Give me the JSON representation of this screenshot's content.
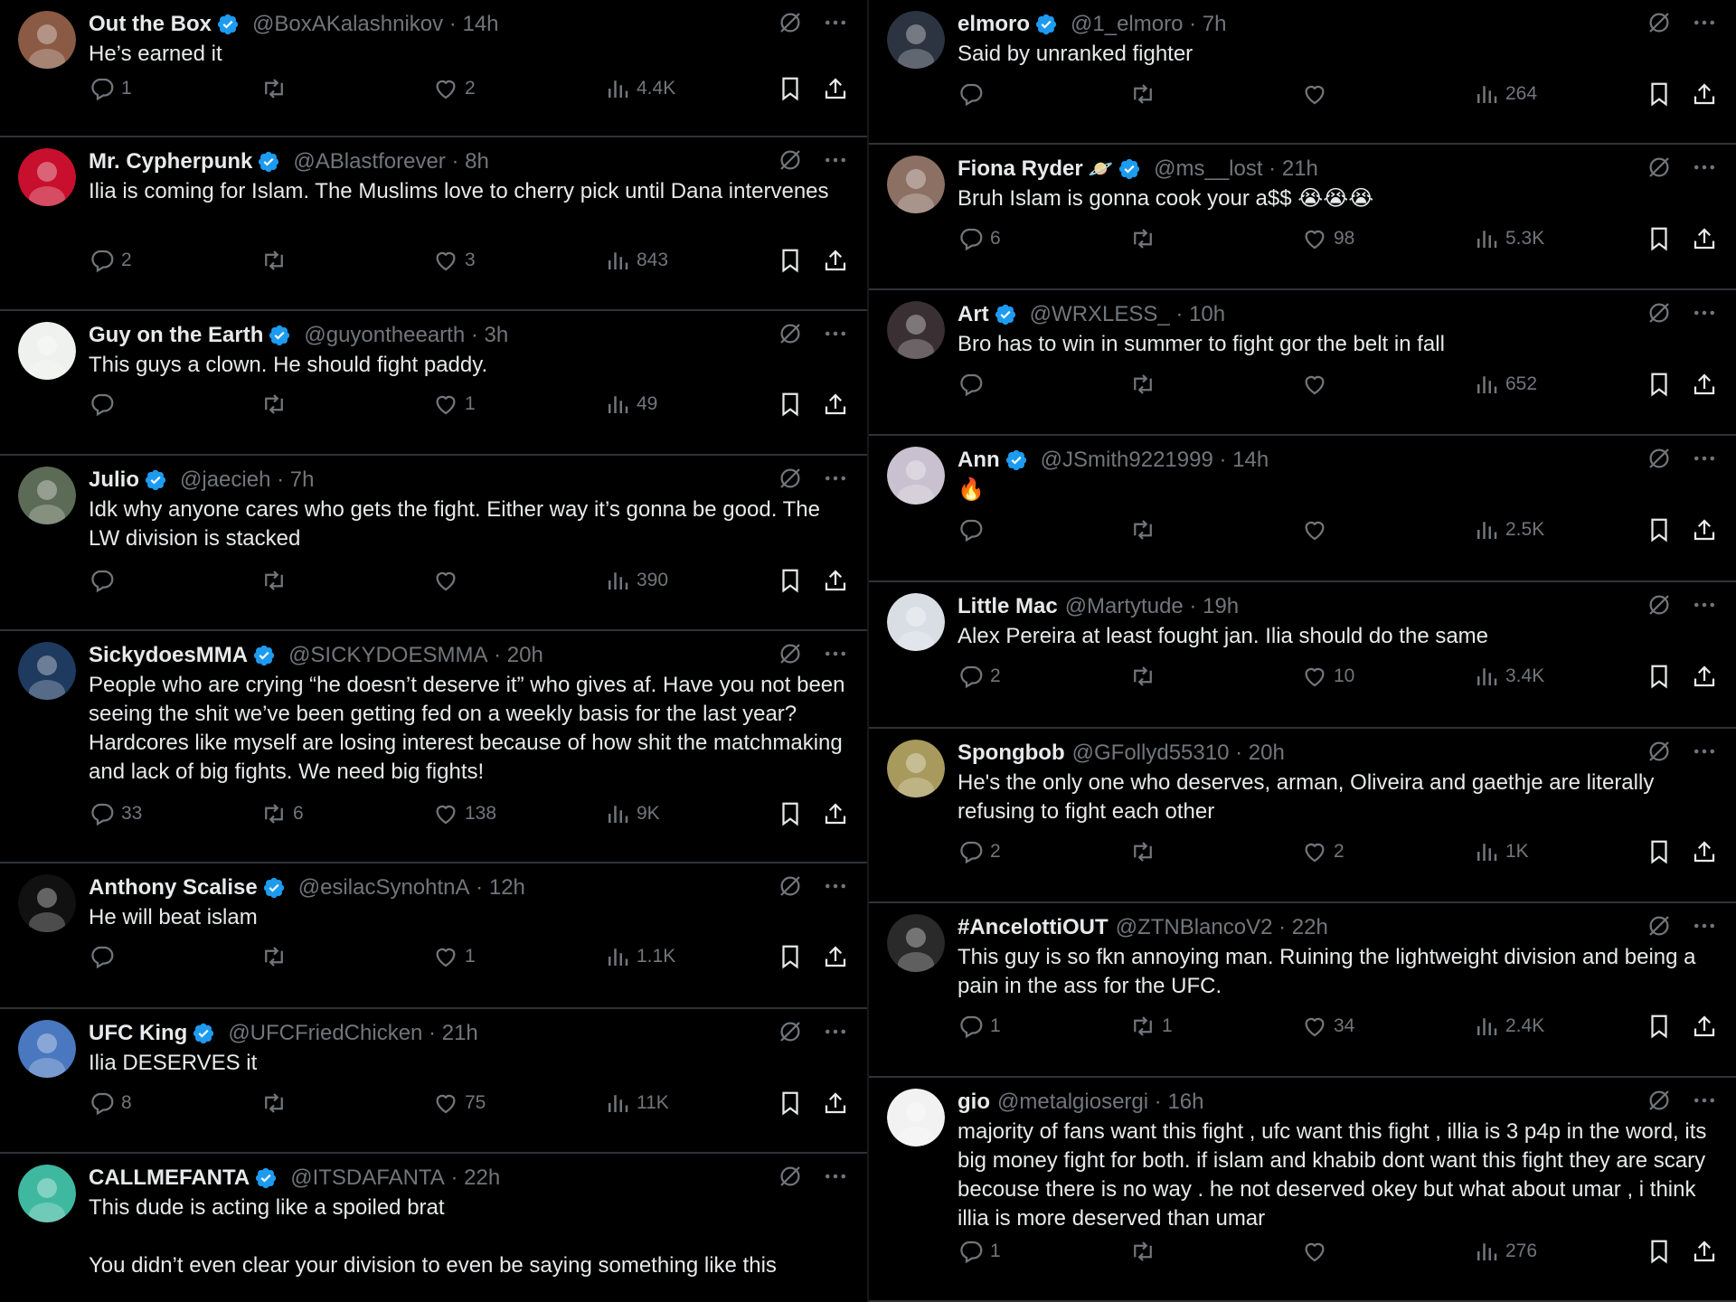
{
  "left_tweets": [
    {
      "name": "Out the Box",
      "verified": true,
      "handle": "@BoxAKalashnikov",
      "time": "14h",
      "text": "He’s earned it",
      "replies": "1",
      "retweets": "",
      "likes": "2",
      "views": "4.4K",
      "avatar": "#8a5a44"
    },
    {
      "name": "Mr. Cypherpunk",
      "verified": true,
      "handle": "@ABlastforever",
      "time": "8h",
      "text": "Ilia is coming for Islam. The Muslims love to cherry pick until Dana intervenes",
      "replies": "2",
      "retweets": "",
      "likes": "3",
      "views": "843",
      "avatar": "#c8102e"
    },
    {
      "name": "Guy on the Earth",
      "verified": true,
      "handle": "@guyontheearth",
      "time": "3h",
      "text": "This guys a clown. He should fight paddy.",
      "replies": "",
      "retweets": "",
      "likes": "1",
      "views": "49",
      "avatar": "#eef1ee"
    },
    {
      "name": "Julio",
      "verified": true,
      "handle": "@jaecieh",
      "time": "7h",
      "text": "Idk why anyone cares who gets the fight. Either way it’s gonna be good. The LW division is stacked",
      "replies": "",
      "retweets": "",
      "likes": "",
      "views": "390",
      "avatar": "#5c6b55"
    },
    {
      "name": "SickydoesMMA",
      "verified": true,
      "handle": "@SICKYDOESMMA",
      "time": "20h",
      "text": "People who are crying “he doesn’t deserve it” who gives af. Have you not been seeing the shit we’ve been getting fed on a weekly basis for the last year? Hardcores like myself are losing interest because of how shit the matchmaking and lack of big fights. We need big fights!",
      "replies": "33",
      "retweets": "6",
      "likes": "138",
      "views": "9K",
      "avatar": "#1e3a5f"
    },
    {
      "name": "Anthony Scalise",
      "verified": true,
      "handle": "@esilacSynohtnA",
      "time": "12h",
      "text": "He will beat islam",
      "replies": "",
      "retweets": "",
      "likes": "1",
      "views": "1.1K",
      "avatar": "#111111"
    },
    {
      "name": "UFC King",
      "verified": true,
      "handle": "@UFCFriedChicken",
      "time": "21h",
      "text": "Ilia DESERVES it",
      "replies": "8",
      "retweets": "",
      "likes": "75",
      "views": "11K",
      "avatar": "#4a78c0"
    },
    {
      "name": "CALLMEFANTA",
      "verified": true,
      "handle": "@ITSDAFANTA",
      "time": "22h",
      "text": "This dude is acting like a spoiled brat\n\nYou didn’t even clear your division to even be saying something like this",
      "replies": "",
      "retweets": "",
      "likes": "",
      "views": "",
      "avatar": "#3fb8a0"
    }
  ],
  "right_tweets": [
    {
      "name": "elmoro",
      "verified": true,
      "handle": "@1_elmoro",
      "time": "7h",
      "text": "Said by unranked fighter",
      "replies": "",
      "retweets": "",
      "likes": "",
      "views": "264",
      "avatar": "#2b3440"
    },
    {
      "name": "Fiona Ryder",
      "badge": "🪐",
      "verified": true,
      "handle": "@ms__lost",
      "time": "21h",
      "text": "Bruh Islam is gonna cook your a$$ 😭😭😭",
      "replies": "6",
      "retweets": "",
      "likes": "98",
      "views": "5.3K",
      "avatar": "#8c7064"
    },
    {
      "name": "Art",
      "verified": true,
      "handle": "@WRXLESS_",
      "time": "10h",
      "text": "Bro has to win in summer to fight gor the belt in fall",
      "replies": "",
      "retweets": "",
      "likes": "",
      "views": "652",
      "avatar": "#3a2f33"
    },
    {
      "name": "Ann",
      "verified": true,
      "handle": "@JSmith9221999",
      "time": "14h",
      "text": "🔥",
      "replies": "",
      "retweets": "",
      "likes": "",
      "views": "2.5K",
      "avatar": "#c9c1cf"
    },
    {
      "name": "Little Mac",
      "verified": false,
      "handle": "@Martytude",
      "time": "19h",
      "text": "Alex Pereira at least fought jan. Ilia should do the same",
      "replies": "2",
      "retweets": "",
      "likes": "10",
      "views": "3.4K",
      "avatar": "#d9dde4"
    },
    {
      "name": "Spongbob",
      "verified": false,
      "handle": "@GFollyd55310",
      "time": "20h",
      "text": "He's the only one who deserves, arman, Oliveira and gaethje are literally refusing to fight each other",
      "replies": "2",
      "retweets": "",
      "likes": "2",
      "views": "1K",
      "avatar": "#a89a5c"
    },
    {
      "name": "#AncelottiOUT",
      "verified": false,
      "handle": "@ZTNBlancoV2",
      "time": "22h",
      "text": "This guy is so fkn annoying man. Ruining the lightweight division and being a pain in the ass for the UFC.",
      "replies": "1",
      "retweets": "1",
      "likes": "34",
      "views": "2.4K",
      "avatar": "#2a2a2a"
    },
    {
      "name": "gio",
      "verified": false,
      "handle": "@metalgiosergi",
      "time": "16h",
      "text": "majority of fans want this fight , ufc want this fight , illia is 3 p4p in the word, its big money fight for both. if islam and khabib dont want this fight they are scary becouse there is no way . he not deserved okey but what about umar , i think illia is more deserved than umar",
      "replies": "1",
      "retweets": "",
      "likes": "",
      "views": "276",
      "avatar": "#f2f2f2"
    }
  ],
  "colors": {
    "verified": "#1d9bf0",
    "muted": "#71767b",
    "divider": "#2f3336",
    "text": "#e7e9ea"
  }
}
